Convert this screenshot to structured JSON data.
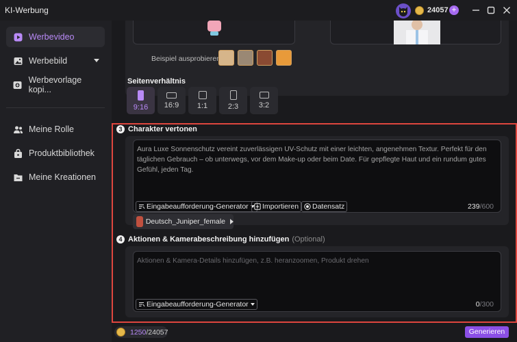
{
  "app": {
    "title": "KI-Werbung",
    "credits": "24057"
  },
  "sidebar": {
    "items": [
      {
        "label": "Werbevideo",
        "icon": "video-icon"
      },
      {
        "label": "Werbebild",
        "icon": "image-icon"
      },
      {
        "label": "Werbevorlage kopi...",
        "icon": "template-copy-icon"
      },
      {
        "label": "Meine Rolle",
        "icon": "users-icon"
      },
      {
        "label": "Produktbibliothek",
        "icon": "product-bag-icon"
      },
      {
        "label": "Meine Kreationen",
        "icon": "folder-icon"
      }
    ]
  },
  "examples": {
    "label": "Beispiel ausprobieren:"
  },
  "aspect_ratio": {
    "title": "Seitenverhältnis",
    "options": [
      "9:16",
      "16:9",
      "1:1",
      "2:3",
      "3:2"
    ],
    "selected": "9:16"
  },
  "character": {
    "step": "3",
    "title": "Charakter vertonen",
    "text": "Aura Luxe Sonnenschutz vereint zuverlässigen UV-Schutz mit einer leichten, angenehmen Textur. Perfekt für den täglichen Gebrauch – ob unterwegs, vor dem Make-up oder beim Date. Für gepflegte Haut und ein rundum gutes Gefühl, jeden Tag.",
    "prompt_generator": "Eingabeaufforderung-Generator",
    "import": "Importieren",
    "dataset": "Datensatz",
    "count": "239",
    "max": "/600",
    "voice": "Deutsch_Juniper_female"
  },
  "actions": {
    "step": "4",
    "title": "Aktionen & Kamerabeschreibung hinzufügen",
    "optional": "(Optional)",
    "placeholder": "Aktionen & Kamera-Details hinzufügen, z.B. heranzoomen, Produkt drehen",
    "prompt_generator": "Eingabeaufforderung-Generator",
    "count": "0",
    "max": "/300"
  },
  "footer": {
    "credits_used": "1250",
    "credits_total": "/24057",
    "generate": "Generieren"
  },
  "colors": {
    "accent": "#b98af7",
    "button": "#8b4fe6",
    "highlight": "#e0463e"
  }
}
